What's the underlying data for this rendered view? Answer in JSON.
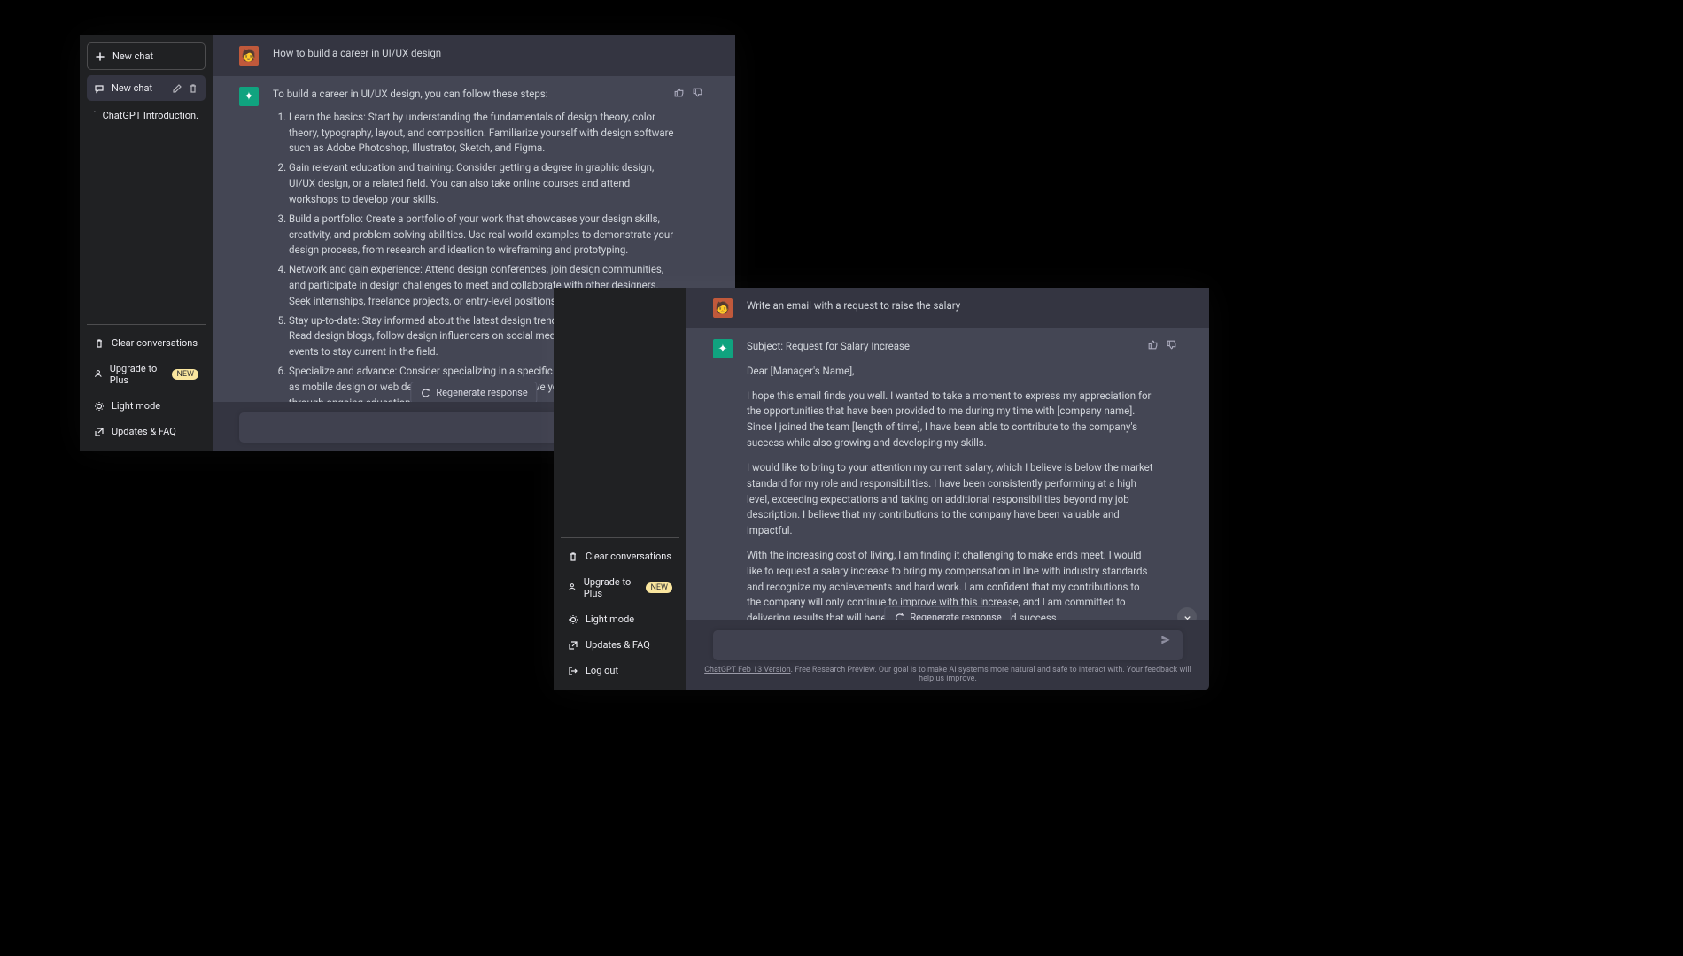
{
  "windowA": {
    "sidebar": {
      "new_chat": "New chat",
      "items": [
        {
          "label": "New chat",
          "active": true
        },
        {
          "label": "ChatGPT Introduction."
        }
      ],
      "bottom": {
        "clear": "Clear conversations",
        "upgrade": "Upgrade to Plus",
        "upgrade_badge": "NEW",
        "light": "Light mode",
        "faq": "Updates & FAQ"
      }
    },
    "conversation": {
      "user_prompt": "How to build a career in UI/UX design",
      "assistant_intro": "To build a career in UI/UX design, you can follow these steps:",
      "steps": [
        "Learn the basics: Start by understanding the fundamentals of design theory, color theory, typography, layout, and composition. Familiarize yourself with design software such as Adobe Photoshop, Illustrator, Sketch, and Figma.",
        "Gain relevant education and training: Consider getting a degree in graphic design, UI/UX design, or a related field. You can also take online courses and attend workshops to develop your skills.",
        "Build a portfolio: Create a portfolio of your work that showcases your design skills, creativity, and problem-solving abilities. Use real-world examples to demonstrate your design process, from research and ideation to wireframing and prototyping.",
        "Network and gain experience: Attend design conferences, join design communities, and participate in design challenges to meet and collaborate with other designers. Seek internships, freelance projects, or entry-level positions to gain experience.",
        "Stay up-to-date: Stay informed about the latest design trends, technologies, and tools. Read design blogs, follow design influencers on social media, and attend design events to stay current in the field.",
        "Specialize and advance: Consider specializing in a specific area of UI/UX design, such as mobile design or web design, and continue to improve your skills and knowledge through ongoing education and training."
      ],
      "regenerate": "Regenerate response"
    }
  },
  "windowB": {
    "sidebar": {
      "bottom": {
        "clear": "Clear conversations",
        "upgrade": "Upgrade to Plus",
        "upgrade_badge": "NEW",
        "light": "Light mode",
        "faq": "Updates & FAQ",
        "logout": "Log out"
      }
    },
    "conversation": {
      "user_prompt": "Write an email with a request to raise the salary",
      "assistant_subject": "Subject: Request for Salary Increase",
      "paragraphs": [
        "Dear [Manager's Name],",
        "I hope this email finds you well. I wanted to take a moment to express my appreciation for the opportunities that have been provided to me during my time with [company name]. Since I joined the team [length of time], I have been able to contribute to the company's success while also growing and developing my skills.",
        "I would like to bring to your attention my current salary, which I believe is below the market standard for my role and responsibilities. I have been consistently performing at a high level, exceeding expectations and taking on additional responsibilities beyond my job description. I believe that my contributions to the company have been valuable and impactful.",
        "With the increasing cost of living, I am finding it challenging to make ends meet. I would like to request a salary increase to bring my compensation in line with industry standards and recognize my achievements and hard work. I am confident that my contributions to the company will only continue to improve with this increase, and I am committed to delivering results that will benefit the company's growth and success."
      ],
      "regenerate": "Regenerate response"
    },
    "footer": {
      "version": "ChatGPT Feb 13 Version",
      "rest": ". Free Research Preview. Our goal is to make AI systems more natural and safe to interact with. Your feedback will help us improve."
    }
  }
}
